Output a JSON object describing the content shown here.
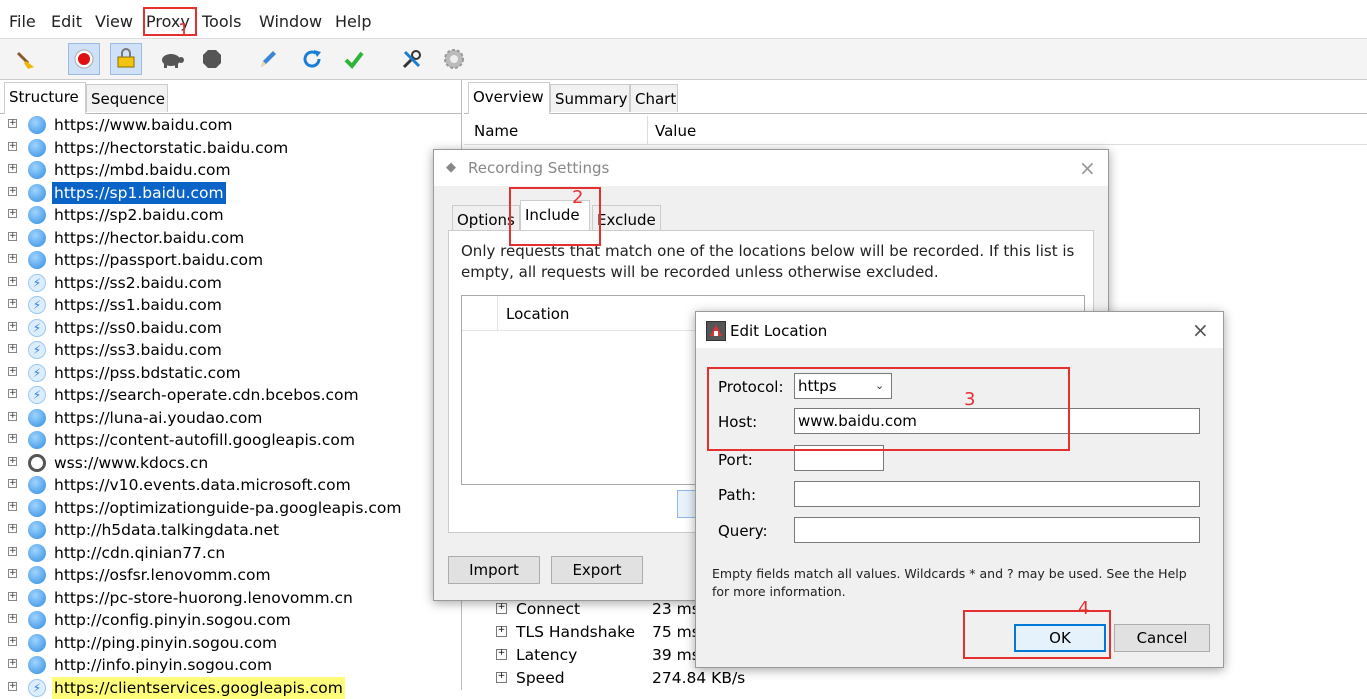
{
  "menu": {
    "file": "File",
    "edit": "Edit",
    "view": "View",
    "proxy": "Proxy",
    "tools": "Tools",
    "window": "Window",
    "help": "Help"
  },
  "left_tabs": {
    "structure": "Structure",
    "sequence": "Sequence"
  },
  "hosts": [
    {
      "label": "https://www.baidu.com",
      "icon": "globe-icon"
    },
    {
      "label": "https://hectorstatic.baidu.com",
      "icon": "globe-icon"
    },
    {
      "label": "https://mbd.baidu.com",
      "icon": "globe-icon"
    },
    {
      "label": "https://sp1.baidu.com",
      "icon": "globe-icon",
      "selected": true
    },
    {
      "label": "https://sp2.baidu.com",
      "icon": "globe-icon"
    },
    {
      "label": "https://hector.baidu.com",
      "icon": "globe-icon"
    },
    {
      "label": "https://passport.baidu.com",
      "icon": "globe-icon"
    },
    {
      "label": "https://ss2.baidu.com",
      "icon": "bolt-icon"
    },
    {
      "label": "https://ss1.baidu.com",
      "icon": "bolt-icon"
    },
    {
      "label": "https://ss0.baidu.com",
      "icon": "bolt-icon"
    },
    {
      "label": "https://ss3.baidu.com",
      "icon": "bolt-icon"
    },
    {
      "label": "https://pss.bdstatic.com",
      "icon": "bolt-icon"
    },
    {
      "label": "https://search-operate.cdn.bcebos.com",
      "icon": "bolt-icon"
    },
    {
      "label": "https://luna-ai.youdao.com",
      "icon": "globe-icon"
    },
    {
      "label": "https://content-autofill.googleapis.com",
      "icon": "globe-icon"
    },
    {
      "label": "wss://www.kdocs.cn",
      "icon": "websocket-icon"
    },
    {
      "label": "https://v10.events.data.microsoft.com",
      "icon": "globe-icon"
    },
    {
      "label": "https://optimizationguide-pa.googleapis.com",
      "icon": "globe-icon"
    },
    {
      "label": "http://h5data.talkingdata.net",
      "icon": "globe-icon"
    },
    {
      "label": "http://cdn.qinian77.cn",
      "icon": "globe-icon"
    },
    {
      "label": "https://osfsr.lenovomm.com",
      "icon": "globe-icon"
    },
    {
      "label": "https://pc-store-huorong.lenovomm.cn",
      "icon": "globe-icon"
    },
    {
      "label": "http://config.pinyin.sogou.com",
      "icon": "globe-icon"
    },
    {
      "label": "http://ping.pinyin.sogou.com",
      "icon": "globe-icon"
    },
    {
      "label": "http://info.pinyin.sogou.com",
      "icon": "globe-icon"
    },
    {
      "label": "https://clientservices.googleapis.com",
      "icon": "bolt-icon",
      "highlighted": true
    }
  ],
  "right_tabs": {
    "overview": "Overview",
    "summary": "Summary",
    "chart": "Chart"
  },
  "grid": {
    "name": "Name",
    "value": "Value"
  },
  "timings": [
    {
      "name": "Connect",
      "value": "23 ms"
    },
    {
      "name": "TLS Handshake",
      "value": "75 ms"
    },
    {
      "name": "Latency",
      "value": "39 ms"
    },
    {
      "name": "Speed",
      "value": "274.84 KB/s"
    }
  ],
  "recording": {
    "title": "Recording Settings",
    "tabs": {
      "options": "Options",
      "include": "Include",
      "exclude": "Exclude"
    },
    "description": "Only requests that match one of the locations below will be recorded. If this list is empty, all requests will be recorded unless otherwise excluded.",
    "column": "Location",
    "import": "Import",
    "export": "Export"
  },
  "edit_location": {
    "title": "Edit Location",
    "protocol_label": "Protocol:",
    "protocol_value": "https",
    "host_label": "Host:",
    "host_value": "www.baidu.com",
    "port_label": "Port:",
    "port_value": "",
    "path_label": "Path:",
    "path_value": "",
    "query_label": "Query:",
    "query_value": "",
    "hint": "Empty fields match all values. Wildcards * and ? may be used. See the Help for more information.",
    "ok": "OK",
    "cancel": "Cancel"
  },
  "annotations": {
    "n1": "1",
    "n2": "2",
    "n3": "3",
    "n4": "4"
  },
  "colors": {
    "annotation_red": "#e53030",
    "selection": "#0a64c8",
    "highlight": "#fffe7a"
  }
}
